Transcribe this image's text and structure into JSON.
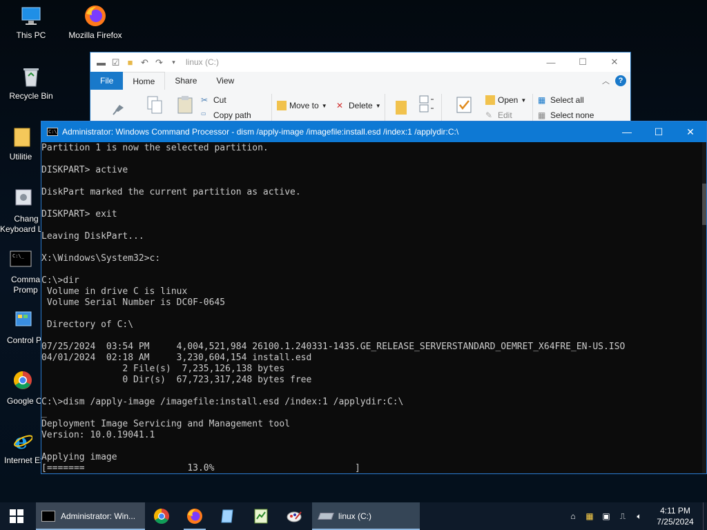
{
  "desktop": {
    "icons": [
      {
        "label": "This PC",
        "icon": "monitor-icon"
      },
      {
        "label": "Mozilla Firefox",
        "icon": "firefox-icon"
      },
      {
        "label": "Recycle Bin",
        "icon": "recycle-bin-icon"
      },
      {
        "label": "Utilitie",
        "icon": "folder-icon"
      },
      {
        "label": "Chang",
        "label2": "Keyboard L",
        "icon": "keyboard-settings-icon"
      },
      {
        "label": "Comma",
        "label2": "Promp",
        "icon": "command-prompt-icon"
      },
      {
        "label": "Control P",
        "icon": "control-panel-icon"
      },
      {
        "label": "Google Ch",
        "icon": "chrome-icon"
      },
      {
        "label": "Internet Ex",
        "icon": "internet-explorer-icon"
      }
    ]
  },
  "explorer": {
    "title": "linux (C:)",
    "tabs": [
      "File",
      "Home",
      "Share",
      "View"
    ],
    "ribbon": {
      "cut": "Cut",
      "copy_path": "Copy path",
      "move_to": "Move to",
      "delete": "Delete",
      "open": "Open",
      "edit": "Edit",
      "select_all": "Select all",
      "select_none": "Select none"
    }
  },
  "cmd": {
    "title": "Administrator: Windows Command Processor - dism  /apply-image /imagefile:install.esd /index:1 /applydir:C:\\",
    "icon_text": "C:\\",
    "lines": [
      "Partition 1 is now the selected partition.",
      "",
      "DISKPART> active",
      "",
      "DiskPart marked the current partition as active.",
      "",
      "DISKPART> exit",
      "",
      "Leaving DiskPart...",
      "",
      "X:\\Windows\\System32>c:",
      "",
      "C:\\>dir",
      " Volume in drive C is linux",
      " Volume Serial Number is DC0F-0645",
      "",
      " Directory of C:\\",
      "",
      "07/25/2024  03:54 PM     4,004,521,984 26100.1.240331-1435.GE_RELEASE_SERVERSTANDARD_OEMRET_X64FRE_EN-US.ISO",
      "04/01/2024  02:18 AM     3,230,604,154 install.esd",
      "               2 File(s)  7,235,126,138 bytes",
      "               0 Dir(s)  67,723,317,248 bytes free",
      "",
      "C:\\>dism /apply-image /imagefile:install.esd /index:1 /applydir:C:\\",
      "_",
      "Deployment Image Servicing and Management tool",
      "Version: 10.0.19041.1",
      "",
      "Applying image",
      "[=======                   13.0%                          ]"
    ],
    "progress_percent": 13.0
  },
  "taskbar": {
    "cmd_task_label": "Administrator: Win...",
    "explorer_task_label": "linux (C:)",
    "pinned": [
      "chrome-icon",
      "firefox-icon",
      "notepad-icon",
      "spreadsheet-icon",
      "paint-icon"
    ],
    "time": "4:11 PM",
    "date": "7/25/2024"
  },
  "colors": {
    "titlebar_active": "#0e79d4",
    "console_bg": "#0c0c0c",
    "console_fg": "#cccccc",
    "taskbar_bg": "#0e1a29",
    "ribbon_tabs_bg": "#1979ca"
  }
}
